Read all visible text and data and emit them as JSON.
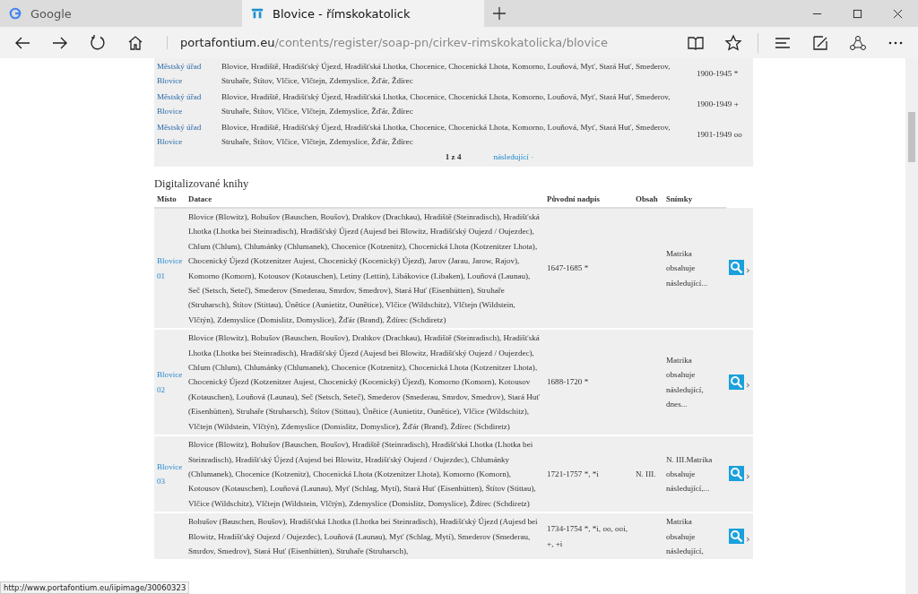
{
  "browser": {
    "tabs": [
      {
        "label": "Google",
        "selected": false,
        "kind": "google"
      },
      {
        "label": "Blovice - římskokatolick",
        "selected": true,
        "kind": "site"
      }
    ],
    "address": {
      "domain": "portafontium.eu",
      "path": "/contents/register/soap-pn/cirkev-rimskokatolicka/blovice"
    }
  },
  "fonds_table": {
    "rows": [
      {
        "place": "Městský úřad Blovice",
        "places": "Blovice, Hradiště, Hradišťský Újezd, Hradišťská Lhotka, Chocenice, Chocenická Lhota, Komorno, Louňová, Myť, Stará Huť, Smederov, Struhaře, Štítov, Vlčice, Vlčtejn, Zdemyslice, Žďár, Ždírec",
        "dates": "1900-1945 *"
      },
      {
        "place": "Městský úřad Blovice",
        "places": "Blovice, Hradiště, Hradišťský Újezd, Hradišťská Lhotka, Chocenice, Chocenická Lhota, Komorno, Louňová, Myť, Stará Huť, Smederov, Struhaře, Štítov, Vlčice, Vlčtejn, Zdemyslice, Žďár, Ždírec",
        "dates": "1900-1949 +"
      },
      {
        "place": "Městský úřad Blovice",
        "places": "Blovice, Hradiště, Hradišťský Újezd, Hradišťská Lhotka, Chocenice, Chocenická Lhota, Komorno, Louňová, Myť, Stará Huť, Smederov, Struhaře, Štítov, Vlčice, Vlčtejn, Zdemyslice, Žďár, Ždírec",
        "dates": "1901-1949 oo"
      }
    ],
    "pagination": {
      "pages": "1 z 4",
      "next": "následující ·"
    }
  },
  "books": {
    "title": "Digitalizované knihy",
    "columns": [
      "Místo",
      "Datace",
      "Původní nadpis",
      "Obsah",
      "Snímky"
    ],
    "rows": [
      {
        "place": "Blovice 01",
        "datace": "Blovice (Blowitz), Bohušov (Bauschen, Boušov), Drahkov (Drachkau), Hradiště (Steinradisch), Hradišťská Lhotka (Lhotka bei Steinradisch), Hradišťský Újezd (Aujesd bei Blowitz, Hradišťský Oujezd / Oujezdec), Chlum (Chlum), Chlumánky (Chlumanek), Chocenice (Kotzenitz), Chocenická Lhota (Kotzenitzer Lhota), Chocenický Újezd (Kotzenitzer Aujest, Chocenický (Kocenický) Újezd), Jarov (Jarau, Jarow, Rajov), Komorno (Komorn), Kotousov (Kotauschen), Letiny (Lettin), Libákovice (Libaken), Louňová (Launau), Seč (Setsch, Seteč), Smederov (Smederau, Smrdov, Smedrov), Stará Huť (Eisenhütten), Struhaře (Struharsch), Štítov (Stittau), Únětice (Aunietitz, Ounětice), Vlčice (Wildschitz), Vlčtejn (Wildstein, Vlčtýn), Zdemyslice (Domislitz, Domyslice), Žďár (Brand), Ždírec (Schdiretz)",
        "original_title": "1647-1685 *",
        "content": "Matrika obsahuje následující..."
      },
      {
        "place": "Blovice 02",
        "datace": "Blovice (Blowitz), Bohušov (Bauschen, Boušov), Drahkov (Drachkau), Hradiště (Steinradisch), Hradišťská Lhotka (Lhotka bei Steinradisch), Hradišťský Újezd (Aujesd bei Blowitz, Hradišťský Oujezd / Oujezdec), Chlum (Chlum), Chlumánky (Chlumanek), Chocenice (Kotzenitz), Chocenická Lhota (Kotzenitzer Lhota), Chocenický Újezd (Kotzenitzer Aujest, Chocenický (Kocenický) Újezd), Komorno (Komorn), Kotousov (Kotauschen), Louňová (Launau), Seč (Setsch, Seteč), Smederov (Smederau, Smrdov, Smedrov), Stará Huť (Eisenhütten), Struhaře (Struharsch), Štítov (Stittau), Únětice (Aunietitz, Ounětice), Vlčice (Wildschitz), Vlčtejn (Wildstein, Vlčtýn), Zdemyslice (Domislitz, Domyslice), Žďár (Brand), Ždírec (Schdiretz)",
        "original_title": "1688-1720 *",
        "content": "Matrika obsahuje následující, dnes..."
      },
      {
        "place": "Blovice 03",
        "datace": "Blovice (Blowitz), Bohušov (Bauschen, Boušov), Hradiště (Steinradisch), Hradišťská Lhotka (Lhotka bei Steinradisch), Hradišťský Újezd (Aujesd bei Blowitz, Hradišťský Oujezd / Oujezdec), Chlumánky (Chlumanek), Chocenice (Kotzenitz), Chocenická Lhota (Kotzenitzer Lhota), Komorno (Komorn), Kotousov (Kotauschen), Louňová (Launau), Myť (Schlag, Mytí), Stará Huť (Eisenhütten), Štítov (Stittau), Vlčice (Wildschitz), Vlčtejn (Wildstein, Vlčtýn), Zdemyslice (Domislitz, Domyslice), Ždírec (Schdiretz)",
        "original_title": "1721-1757 *, *i",
        "obsah": "N. III.",
        "content": "N. III.Matrika obsahuje následující,..."
      },
      {
        "datace": "Bohušov (Bauschen, Boušov), Hradišťská Lhotka (Lhotka bei Steinradisch), Hradišťský Újezd (Aujesd bei Blowitz, Hradišťský Oujezd / Oujezdec), Louňová (Launau), Myť (Schlag, Mytí), Smederov (Smederau, Smrdov, Smedrov), Stará Huť (Eisenhütten), Struhaře (Struharsch),",
        "original_title": "1734-1754 *, *i, oo, ooi, +, +i",
        "content": "Matrika obsahuje následující,"
      }
    ]
  },
  "status_url": "http://www.portafontium.eu/iipimage/30060323"
}
